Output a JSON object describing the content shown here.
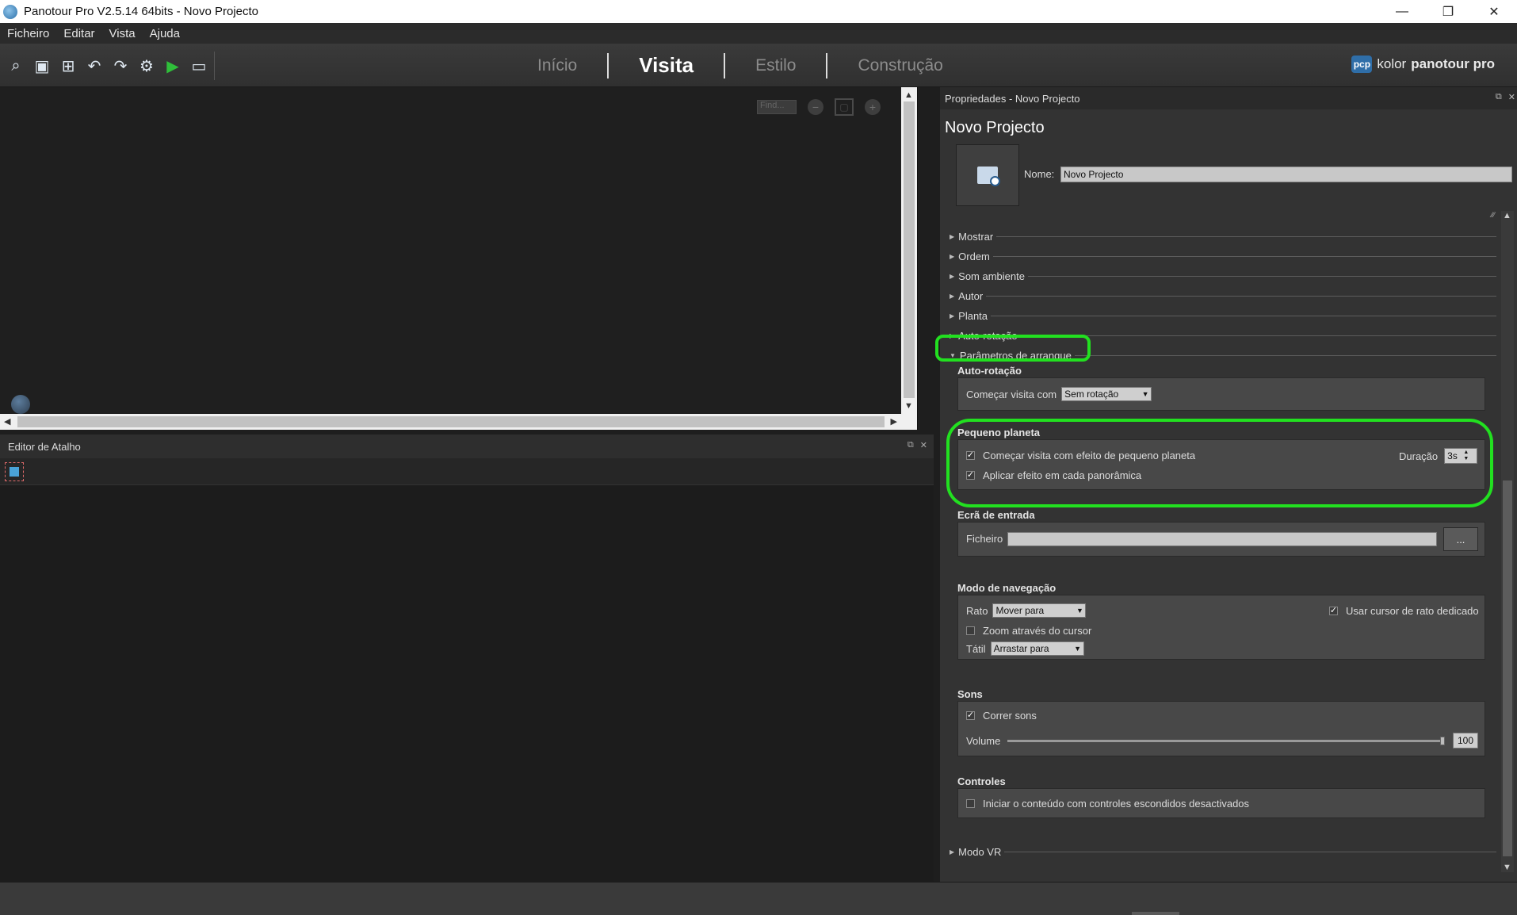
{
  "window": {
    "title": "Panotour Pro V2.5.14 64bits - Novo Projecto",
    "minimize": "—",
    "maximize": "❐",
    "close": "✕"
  },
  "menu": [
    "Ficheiro",
    "Editar",
    "Vista",
    "Ajuda"
  ],
  "toolbar": {
    "icons": [
      "find-icon",
      "save-icon",
      "add-panorama-icon",
      "undo-icon",
      "redo-icon",
      "settings-icon",
      "play-icon",
      "folder-icon"
    ],
    "tabs": [
      "Início",
      "Visita",
      "Estilo",
      "Construção"
    ],
    "active_tab": "Visita",
    "brand_badge": "pcp",
    "brand_text_1": "kolor",
    "brand_text_2": "panotour pro"
  },
  "viewer": {
    "fov_value": "Find..."
  },
  "shortcut_editor": {
    "title": "Editor de Atalho"
  },
  "properties": {
    "header": "Propriedades - Novo Projecto",
    "project_title": "Novo Projecto",
    "name_label": "Nome:",
    "name_value": "Novo Projecto",
    "sections": [
      "Mostrar",
      "Ordem",
      "Som ambiente",
      "Autor",
      "Planta",
      "Auto-rotação"
    ],
    "expanded_section": "Parâmetros de arranque",
    "autorotation": {
      "title": "Auto-rotação",
      "start_label": "Começar visita com",
      "start_value": "Sem rotação"
    },
    "little_planet": {
      "title": "Pequeno planeta",
      "start_effect_label": "Começar visita com efeito de pequeno planeta",
      "start_effect_checked": true,
      "apply_each_label": "Aplicar efeito em cada panorâmica",
      "apply_each_checked": true,
      "duration_label": "Duração",
      "duration_value": "3s"
    },
    "entry_screen": {
      "title": "Ecrã de entrada",
      "file_label": "Ficheiro",
      "browse_label": "..."
    },
    "navigation": {
      "title": "Modo de navegação",
      "mouse_label": "Rato",
      "mouse_value": "Mover para",
      "dedicated_cursor_label": "Usar cursor de rato dedicado",
      "dedicated_cursor_checked": true,
      "zoom_cursor_label": "Zoom através do cursor",
      "zoom_cursor_checked": false,
      "touch_label": "Tátil",
      "touch_value": "Arrastar para"
    },
    "sounds": {
      "title": "Sons",
      "play_sounds_label": "Correr sons",
      "play_sounds_checked": true,
      "volume_label": "Volume",
      "volume_value": "100",
      "volume_fraction": 1.0
    },
    "controls": {
      "title": "Controles",
      "hidden_controls_label": "Iniciar o conteúdo com controles escondidos desactivados",
      "hidden_controls_checked": false
    },
    "vr_section": "Modo VR"
  },
  "colors": {
    "annotation": "#22e020",
    "panel_bg": "#333333",
    "group_bg": "#484848"
  }
}
